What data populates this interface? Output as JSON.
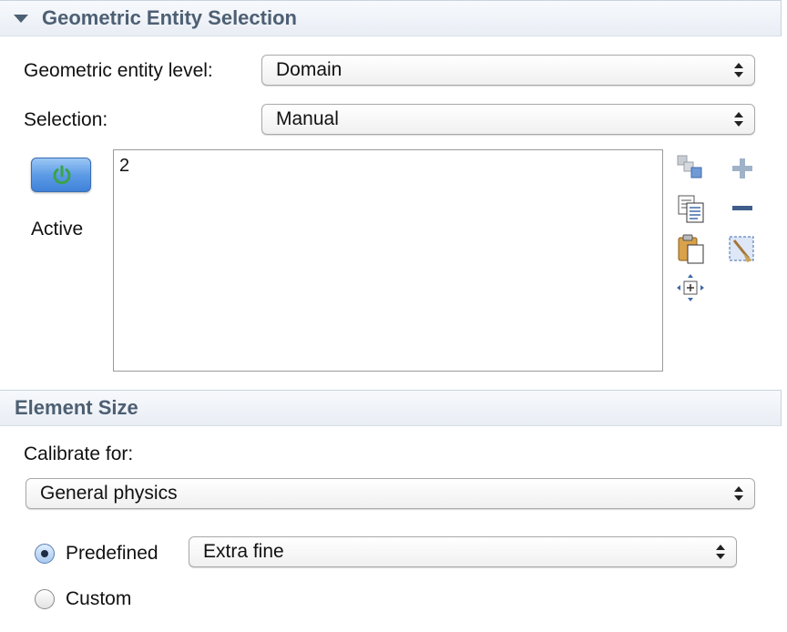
{
  "geometric_entity_selection": {
    "header": "Geometric Entity Selection",
    "entity_level_label": "Geometric entity level:",
    "entity_level_value": "Domain",
    "selection_label": "Selection:",
    "selection_value": "Manual",
    "active_label": "Active",
    "selected_items": [
      "2"
    ],
    "toolbar_icons": [
      "copy-selection-icon",
      "add-icon",
      "copy-icon",
      "remove-icon",
      "paste-icon",
      "clear-selection-icon",
      "zoom-to-selection-icon"
    ]
  },
  "element_size": {
    "header": "Element Size",
    "calibrate_label": "Calibrate for:",
    "calibrate_value": "General physics",
    "predefined_label": "Predefined",
    "predefined_value": "Extra fine",
    "custom_label": "Custom",
    "selected_option": "Predefined"
  },
  "colors": {
    "header_text": "#4d5f73",
    "active_button": "#5d9be6",
    "power_icon": "#3aa34a"
  }
}
